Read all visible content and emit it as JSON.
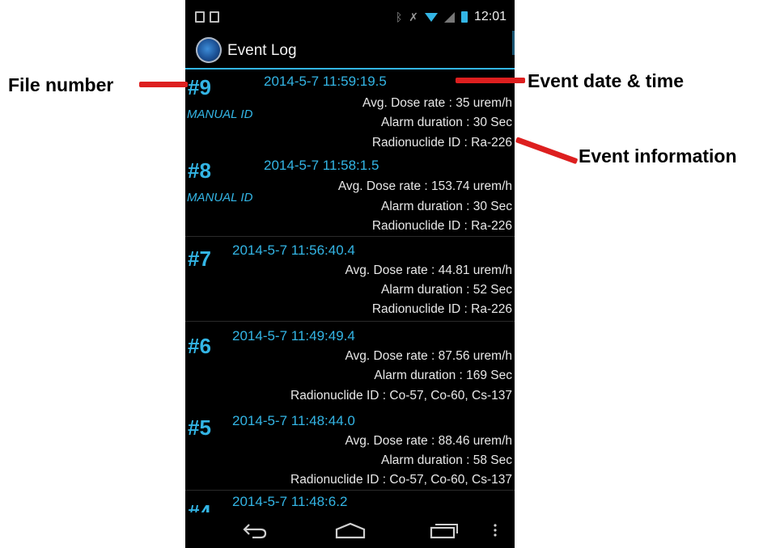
{
  "status": {
    "time": "12:01"
  },
  "header": {
    "title": "Event Log"
  },
  "events": [
    {
      "num": "#9",
      "tag": "MANUAL ID",
      "datetime": "2014-5-7  11:59:19.5",
      "dose": "Avg. Dose rate : 35 urem/h",
      "alarm": "Alarm duration : 30 Sec",
      "radionuclide": "Radionuclide ID : Ra-226"
    },
    {
      "num": "#8",
      "tag": "MANUAL ID",
      "datetime": "2014-5-7  11:58:1.5",
      "dose": "Avg. Dose rate : 153.74 urem/h",
      "alarm": "Alarm duration : 30 Sec",
      "radionuclide": "Radionuclide ID : Ra-226"
    },
    {
      "num": "#7",
      "tag": "",
      "datetime": "2014-5-7  11:56:40.4",
      "dose": "Avg. Dose rate : 44.81 urem/h",
      "alarm": "Alarm duration : 52 Sec",
      "radionuclide": "Radionuclide ID : Ra-226"
    },
    {
      "num": "#6",
      "tag": "",
      "datetime": "2014-5-7  11:49:49.4",
      "dose": "Avg. Dose rate : 87.56 urem/h",
      "alarm": "Alarm duration : 169 Sec",
      "radionuclide": "Radionuclide ID : Co-57, Co-60, Cs-137"
    },
    {
      "num": "#5",
      "tag": "",
      "datetime": "2014-5-7  11:48:44.0",
      "dose": "Avg. Dose rate : 88.46 urem/h",
      "alarm": "Alarm duration : 58 Sec",
      "radionuclide": "Radionuclide ID : Co-57, Co-60, Cs-137"
    },
    {
      "num": "#4",
      "tag": "",
      "datetime": "2014-5-7  11:48:6.2",
      "dose": "",
      "alarm": "",
      "radionuclide": ""
    }
  ],
  "annotations": {
    "file_number": "File number",
    "event_datetime": "Event date & time",
    "event_information": "Event information",
    "arrow_color": "#dd1f1f"
  },
  "icons": {
    "status_left": [
      "notification-icon",
      "image-icon"
    ],
    "status_right": [
      "bluetooth-icon",
      "running-icon",
      "wifi-icon",
      "signal-icon",
      "battery-icon"
    ],
    "nav": [
      "back-icon",
      "home-icon",
      "recent-apps-icon",
      "overflow-menu-icon"
    ]
  },
  "accent_color": "#33b5e5"
}
